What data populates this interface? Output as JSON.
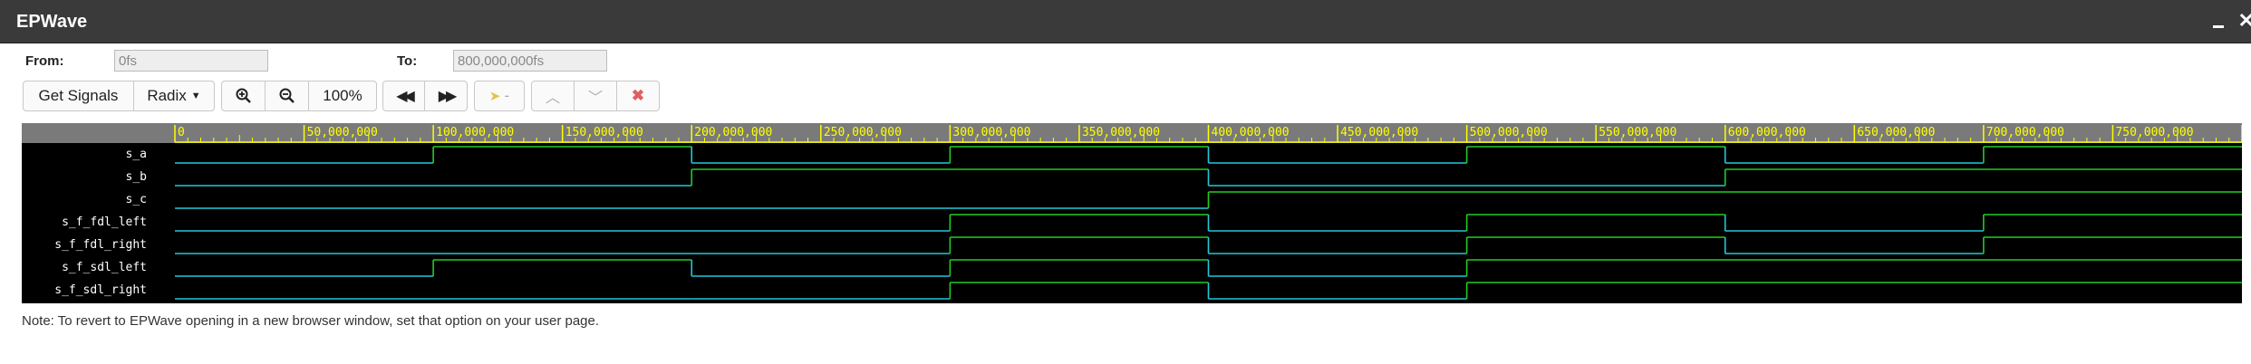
{
  "window": {
    "title": "EPWave"
  },
  "range": {
    "from_label": "From:",
    "from_value": "0fs",
    "to_label": "To:",
    "to_value": "800,000,000fs"
  },
  "toolbar": {
    "get_signals": "Get Signals",
    "radix": "Radix",
    "zoom_level": "100%",
    "cursor_label": "-"
  },
  "timeline": {
    "ticks": [
      "0",
      "50,000,000",
      "100,000,000",
      "150,000,000",
      "200,000,000",
      "250,000,000",
      "300,000,000",
      "350,000,000",
      "400,000,000",
      "450,000,000",
      "500,000,000",
      "550,000,000",
      "600,000,000",
      "650,000,000",
      "700,000,000",
      "750,000,000"
    ],
    "max": 800000000
  },
  "signals": [
    {
      "name": "s_a",
      "changes": [
        [
          0,
          0
        ],
        [
          100000000,
          1
        ],
        [
          200000000,
          0
        ],
        [
          300000000,
          1
        ],
        [
          400000000,
          0
        ],
        [
          500000000,
          1
        ],
        [
          600000000,
          0
        ],
        [
          700000000,
          1
        ]
      ]
    },
    {
      "name": "s_b",
      "changes": [
        [
          0,
          0
        ],
        [
          200000000,
          1
        ],
        [
          400000000,
          0
        ],
        [
          600000000,
          1
        ]
      ]
    },
    {
      "name": "s_c",
      "changes": [
        [
          0,
          0
        ],
        [
          400000000,
          1
        ]
      ]
    },
    {
      "name": "s_f_fdl_left",
      "changes": [
        [
          0,
          0
        ],
        [
          300000000,
          1
        ],
        [
          400000000,
          0
        ],
        [
          500000000,
          1
        ],
        [
          600000000,
          0
        ],
        [
          700000000,
          1
        ]
      ]
    },
    {
      "name": "s_f_fdl_right",
      "changes": [
        [
          0,
          0
        ],
        [
          300000000,
          1
        ],
        [
          400000000,
          0
        ],
        [
          500000000,
          1
        ],
        [
          600000000,
          0
        ],
        [
          700000000,
          1
        ]
      ]
    },
    {
      "name": "s_f_sdl_left",
      "changes": [
        [
          0,
          0
        ],
        [
          100000000,
          1
        ],
        [
          200000000,
          0
        ],
        [
          300000000,
          1
        ],
        [
          400000000,
          0
        ],
        [
          500000000,
          1
        ]
      ]
    },
    {
      "name": "s_f_sdl_right",
      "changes": [
        [
          0,
          0
        ],
        [
          200000000,
          0
        ],
        [
          300000000,
          1
        ],
        [
          400000000,
          0
        ],
        [
          500000000,
          1
        ]
      ]
    }
  ],
  "colors": {
    "high": "#22cc22",
    "low": "#22c8d8",
    "ruler_text": "#ffff00"
  },
  "note": "Note: To revert to EPWave opening in a new browser window, set that option on your user page."
}
